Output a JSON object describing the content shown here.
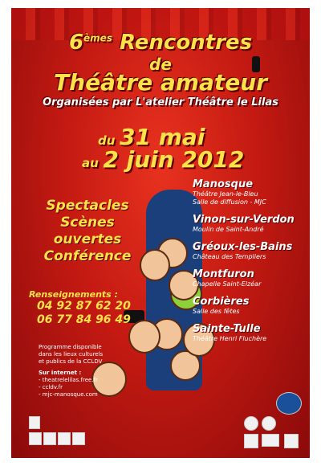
{
  "header": {
    "edition_num": "6",
    "edition_sup": "èmes",
    "title_word": "Rencontres",
    "de": "de",
    "title_main": "Théâtre amateur",
    "organizer": "Organisées par L'atelier Théâtre le Lilas"
  },
  "dates": {
    "du": "du",
    "start": "31 mai",
    "au": "au",
    "end": "2 juin 2012"
  },
  "program": [
    "Spectacles",
    "Scènes ouvertes",
    "Conférence"
  ],
  "venues": [
    {
      "city": "Manosque",
      "places": [
        "Théâtre Jean-le-Bleu",
        "Salle de diffusion - MJC"
      ]
    },
    {
      "city": "Vinon-sur-Verdon",
      "places": [
        "Moulin de Saint-André"
      ]
    },
    {
      "city": "Gréoux-les-Bains",
      "places": [
        "Château des Templiers"
      ]
    },
    {
      "city": "Montfuron",
      "places": [
        "Chapelle Saint-Elzéar"
      ]
    },
    {
      "city": "Corbières",
      "places": [
        "Salle des fêtes"
      ]
    },
    {
      "city": "Sainte-Tulle",
      "places": [
        "Théâtre Henri Fluchère"
      ]
    }
  ],
  "contact": {
    "label": "Renseignements :",
    "phones": [
      "04 92 87 62 20",
      "06 77 84 96 49"
    ]
  },
  "info": {
    "program_note": [
      "Programme disponible",
      "dans les lieux culturels",
      "et publics de la CCLDV"
    ],
    "internet_label": "Sur internet :",
    "links": [
      "- theatrelelilas.free.fr",
      "- ccldv.fr",
      "- mjc-manosque.com"
    ]
  },
  "colors": {
    "background": "#c41a12",
    "headline": "#ffe14a",
    "text": "#ffffff"
  }
}
